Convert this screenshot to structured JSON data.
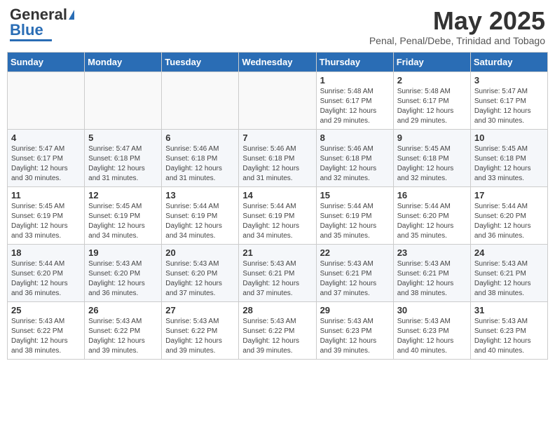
{
  "logo": {
    "general": "General",
    "blue": "Blue"
  },
  "title": "May 2025",
  "subtitle": "Penal, Penal/Debe, Trinidad and Tobago",
  "days_of_week": [
    "Sunday",
    "Monday",
    "Tuesday",
    "Wednesday",
    "Thursday",
    "Friday",
    "Saturday"
  ],
  "weeks": [
    [
      {
        "day": "",
        "info": ""
      },
      {
        "day": "",
        "info": ""
      },
      {
        "day": "",
        "info": ""
      },
      {
        "day": "",
        "info": ""
      },
      {
        "day": "1",
        "sunrise": "5:48 AM",
        "sunset": "6:17 PM",
        "daylight": "12 hours and 29 minutes."
      },
      {
        "day": "2",
        "sunrise": "5:48 AM",
        "sunset": "6:17 PM",
        "daylight": "12 hours and 29 minutes."
      },
      {
        "day": "3",
        "sunrise": "5:47 AM",
        "sunset": "6:17 PM",
        "daylight": "12 hours and 30 minutes."
      }
    ],
    [
      {
        "day": "4",
        "sunrise": "5:47 AM",
        "sunset": "6:17 PM",
        "daylight": "12 hours and 30 minutes."
      },
      {
        "day": "5",
        "sunrise": "5:47 AM",
        "sunset": "6:18 PM",
        "daylight": "12 hours and 31 minutes."
      },
      {
        "day": "6",
        "sunrise": "5:46 AM",
        "sunset": "6:18 PM",
        "daylight": "12 hours and 31 minutes."
      },
      {
        "day": "7",
        "sunrise": "5:46 AM",
        "sunset": "6:18 PM",
        "daylight": "12 hours and 31 minutes."
      },
      {
        "day": "8",
        "sunrise": "5:46 AM",
        "sunset": "6:18 PM",
        "daylight": "12 hours and 32 minutes."
      },
      {
        "day": "9",
        "sunrise": "5:45 AM",
        "sunset": "6:18 PM",
        "daylight": "12 hours and 32 minutes."
      },
      {
        "day": "10",
        "sunrise": "5:45 AM",
        "sunset": "6:18 PM",
        "daylight": "12 hours and 33 minutes."
      }
    ],
    [
      {
        "day": "11",
        "sunrise": "5:45 AM",
        "sunset": "6:19 PM",
        "daylight": "12 hours and 33 minutes."
      },
      {
        "day": "12",
        "sunrise": "5:45 AM",
        "sunset": "6:19 PM",
        "daylight": "12 hours and 34 minutes."
      },
      {
        "day": "13",
        "sunrise": "5:44 AM",
        "sunset": "6:19 PM",
        "daylight": "12 hours and 34 minutes."
      },
      {
        "day": "14",
        "sunrise": "5:44 AM",
        "sunset": "6:19 PM",
        "daylight": "12 hours and 34 minutes."
      },
      {
        "day": "15",
        "sunrise": "5:44 AM",
        "sunset": "6:19 PM",
        "daylight": "12 hours and 35 minutes."
      },
      {
        "day": "16",
        "sunrise": "5:44 AM",
        "sunset": "6:20 PM",
        "daylight": "12 hours and 35 minutes."
      },
      {
        "day": "17",
        "sunrise": "5:44 AM",
        "sunset": "6:20 PM",
        "daylight": "12 hours and 36 minutes."
      }
    ],
    [
      {
        "day": "18",
        "sunrise": "5:44 AM",
        "sunset": "6:20 PM",
        "daylight": "12 hours and 36 minutes."
      },
      {
        "day": "19",
        "sunrise": "5:43 AM",
        "sunset": "6:20 PM",
        "daylight": "12 hours and 36 minutes."
      },
      {
        "day": "20",
        "sunrise": "5:43 AM",
        "sunset": "6:20 PM",
        "daylight": "12 hours and 37 minutes."
      },
      {
        "day": "21",
        "sunrise": "5:43 AM",
        "sunset": "6:21 PM",
        "daylight": "12 hours and 37 minutes."
      },
      {
        "day": "22",
        "sunrise": "5:43 AM",
        "sunset": "6:21 PM",
        "daylight": "12 hours and 37 minutes."
      },
      {
        "day": "23",
        "sunrise": "5:43 AM",
        "sunset": "6:21 PM",
        "daylight": "12 hours and 38 minutes."
      },
      {
        "day": "24",
        "sunrise": "5:43 AM",
        "sunset": "6:21 PM",
        "daylight": "12 hours and 38 minutes."
      }
    ],
    [
      {
        "day": "25",
        "sunrise": "5:43 AM",
        "sunset": "6:22 PM",
        "daylight": "12 hours and 38 minutes."
      },
      {
        "day": "26",
        "sunrise": "5:43 AM",
        "sunset": "6:22 PM",
        "daylight": "12 hours and 39 minutes."
      },
      {
        "day": "27",
        "sunrise": "5:43 AM",
        "sunset": "6:22 PM",
        "daylight": "12 hours and 39 minutes."
      },
      {
        "day": "28",
        "sunrise": "5:43 AM",
        "sunset": "6:22 PM",
        "daylight": "12 hours and 39 minutes."
      },
      {
        "day": "29",
        "sunrise": "5:43 AM",
        "sunset": "6:23 PM",
        "daylight": "12 hours and 39 minutes."
      },
      {
        "day": "30",
        "sunrise": "5:43 AM",
        "sunset": "6:23 PM",
        "daylight": "12 hours and 40 minutes."
      },
      {
        "day": "31",
        "sunrise": "5:43 AM",
        "sunset": "6:23 PM",
        "daylight": "12 hours and 40 minutes."
      }
    ]
  ]
}
